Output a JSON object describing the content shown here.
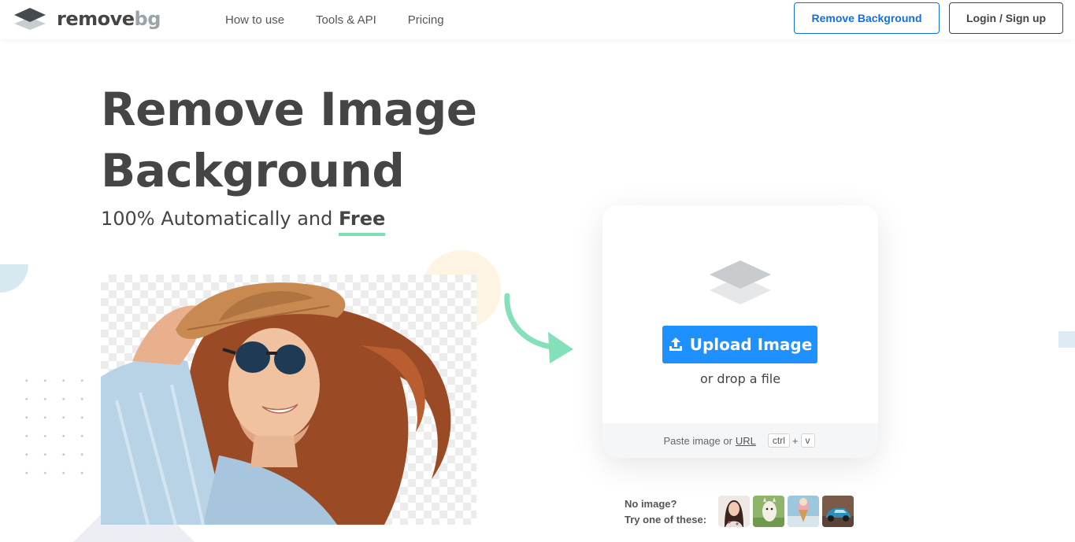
{
  "header": {
    "logo": {
      "part1": "remove",
      "part2": "bg"
    },
    "nav": [
      "How to use",
      "Tools & API",
      "Pricing"
    ],
    "remove_bg_label": "Remove Background",
    "login_label": "Login / Sign up"
  },
  "hero": {
    "title_line1": "Remove Image",
    "title_line2": "Background",
    "subtitle": "100% Automatically and",
    "subtitle_emphasis": "Free"
  },
  "upload": {
    "button_label": "Upload Image",
    "drop_text": "or drop a file",
    "paste_text": "Paste image or",
    "url_label": "URL",
    "key1": "ctrl",
    "plus": "+",
    "key2": "v"
  },
  "samples": {
    "line1": "No image?",
    "line2": "Try one of these:",
    "thumbnails": [
      "woman-photo",
      "llama-photo",
      "ice-cream-photo",
      "car-photo"
    ]
  },
  "colors": {
    "accent": "#1e90ff",
    "brand_blue": "#0f70e6",
    "text": "#454545",
    "underline": "#7de0b2"
  }
}
